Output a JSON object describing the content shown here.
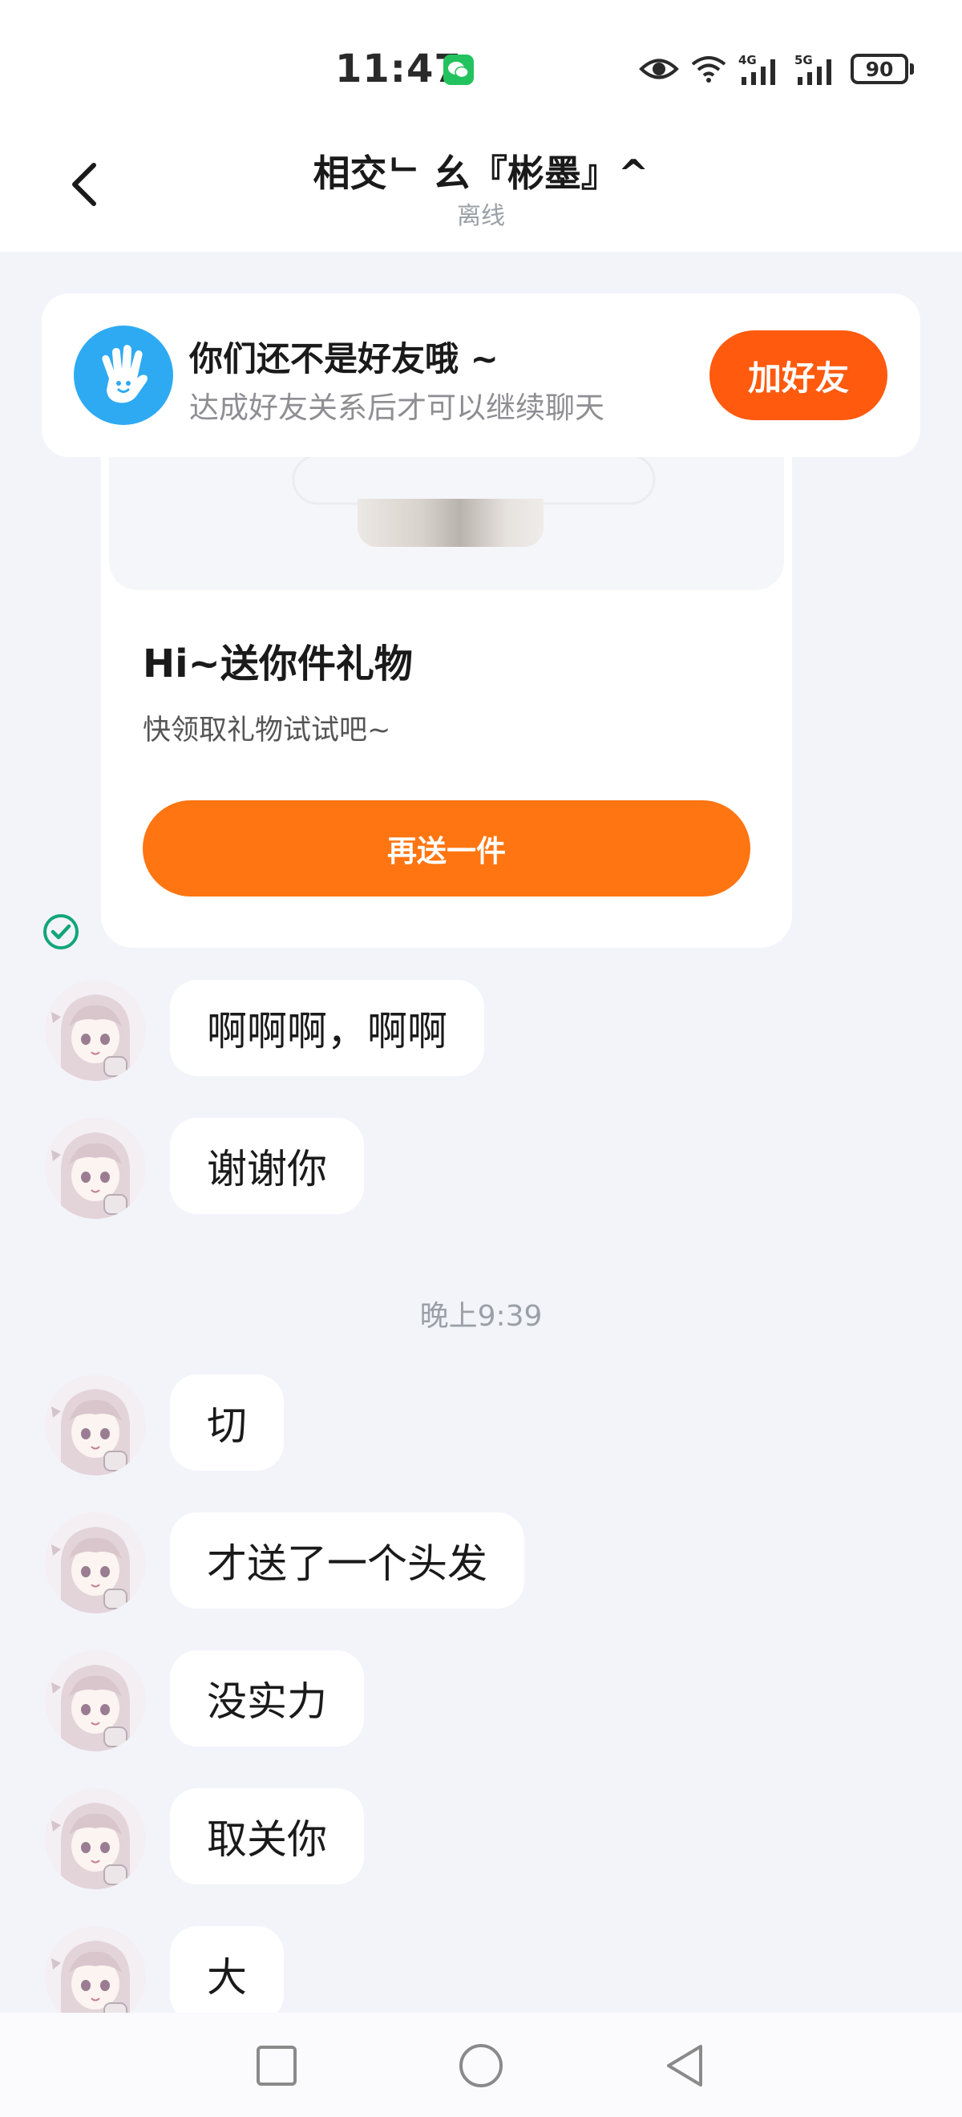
{
  "status_bar": {
    "time": "11:47",
    "network_1": "4G",
    "network_2": "5G",
    "battery": "90",
    "icons": [
      "wechat-icon",
      "eye-icon",
      "wifi-icon",
      "signal-4g-icon",
      "signal-5g-icon",
      "battery-icon"
    ]
  },
  "header": {
    "title": "相交ᄂ 幺『彬墨』^",
    "status": "离线"
  },
  "friend_banner": {
    "title": "你们还不是好友哦 ~",
    "subtitle": "达成好友关系后才可以继续聊天",
    "button": "加好友"
  },
  "gift_card": {
    "title": "Hi~送你件礼物",
    "subtitle": "快领取礼物试试吧~",
    "button": "再送一件"
  },
  "messages_before": [
    {
      "text": "啊啊啊，啊啊"
    },
    {
      "text": "谢谢你"
    }
  ],
  "time_divider": "晚上9:39",
  "messages_after": [
    {
      "text": "切"
    },
    {
      "text": "才送了一个头发"
    },
    {
      "text": "没实力"
    },
    {
      "text": "取关你"
    },
    {
      "text": "大"
    }
  ],
  "colors": {
    "accent": "#ff5a0e",
    "gift_button": "#ff7512",
    "background": "#f3f4fa",
    "read_check": "#13a57a"
  }
}
